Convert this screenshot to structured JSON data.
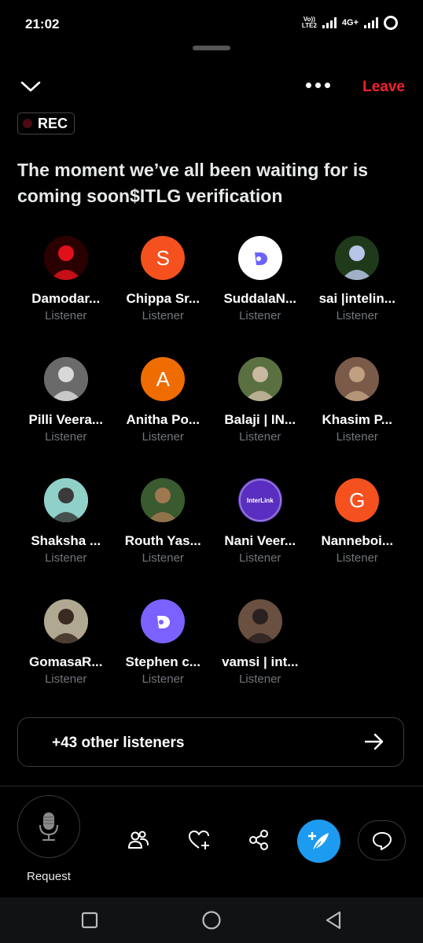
{
  "status": {
    "time": "21:02",
    "volte": "Vo)) LTE2",
    "network": "4G+"
  },
  "header": {
    "leave_label": "Leave",
    "rec_label": "REC"
  },
  "space": {
    "title": "The moment we’ve all been waiting for is coming soon$ITLG verification"
  },
  "listeners": [
    {
      "name": "Damodar...",
      "role": "Listener",
      "avatar": {
        "type": "image",
        "bg": "#2a0000",
        "accent": "#e0101a"
      }
    },
    {
      "name": "Chippa Sr...",
      "role": "Listener",
      "avatar": {
        "type": "letter",
        "letter": "S",
        "bg": "#f4511e"
      }
    },
    {
      "name": "SuddalaN...",
      "role": "Listener",
      "avatar": {
        "type": "logo",
        "bg": "#ffffff",
        "accent": "#6c63ff"
      }
    },
    {
      "name": "sai |intelin...",
      "role": "Listener",
      "avatar": {
        "type": "image",
        "bg": "#1e3a1a",
        "accent": "#b8c4e8"
      }
    },
    {
      "name": "Pilli Veera...",
      "role": "Listener",
      "avatar": {
        "type": "image",
        "bg": "#6a6a6a",
        "accent": "#d8d8d8"
      }
    },
    {
      "name": "Anitha Po...",
      "role": "Listener",
      "avatar": {
        "type": "letter",
        "letter": "A",
        "bg": "#ef6c00"
      }
    },
    {
      "name": "Balaji | IN...",
      "role": "Listener",
      "avatar": {
        "type": "image",
        "bg": "#5a7040",
        "accent": "#c9b8a0"
      }
    },
    {
      "name": "Khasim P...",
      "role": "Listener",
      "avatar": {
        "type": "image",
        "bg": "#7a5a48",
        "accent": "#c0a080"
      }
    },
    {
      "name": "Shaksha ...",
      "role": "Listener",
      "avatar": {
        "type": "image",
        "bg": "#8fd0c8",
        "accent": "#3a3a3a"
      }
    },
    {
      "name": "Routh Yas...",
      "role": "Listener",
      "avatar": {
        "type": "image",
        "bg": "#3a5a30",
        "accent": "#a07850"
      }
    },
    {
      "name": "Nani Veer...",
      "role": "Listener",
      "avatar": {
        "type": "logo",
        "bg": "#5a2ec0",
        "accent": "#ffffff",
        "text": "InterLink"
      }
    },
    {
      "name": "Nanneboi...",
      "role": "Listener",
      "avatar": {
        "type": "letter",
        "letter": "G",
        "bg": "#f4511e"
      }
    },
    {
      "name": "GomasaR...",
      "role": "Listener",
      "avatar": {
        "type": "image",
        "bg": "#b0a890",
        "accent": "#3a2a20"
      }
    },
    {
      "name": "Stephen c...",
      "role": "Listener",
      "avatar": {
        "type": "logo",
        "bg": "#7b61ff",
        "accent": "#ffffff"
      }
    },
    {
      "name": "vamsi | int...",
      "role": "Listener",
      "avatar": {
        "type": "image",
        "bg": "#6a5040",
        "accent": "#2a2020"
      }
    }
  ],
  "other_listeners": {
    "label": "+43 other listeners"
  },
  "footer": {
    "request_label": "Request"
  },
  "colors": {
    "accent_blue": "#1d9bf0",
    "leave_red": "#f4212e",
    "muted_text": "#71767b"
  }
}
